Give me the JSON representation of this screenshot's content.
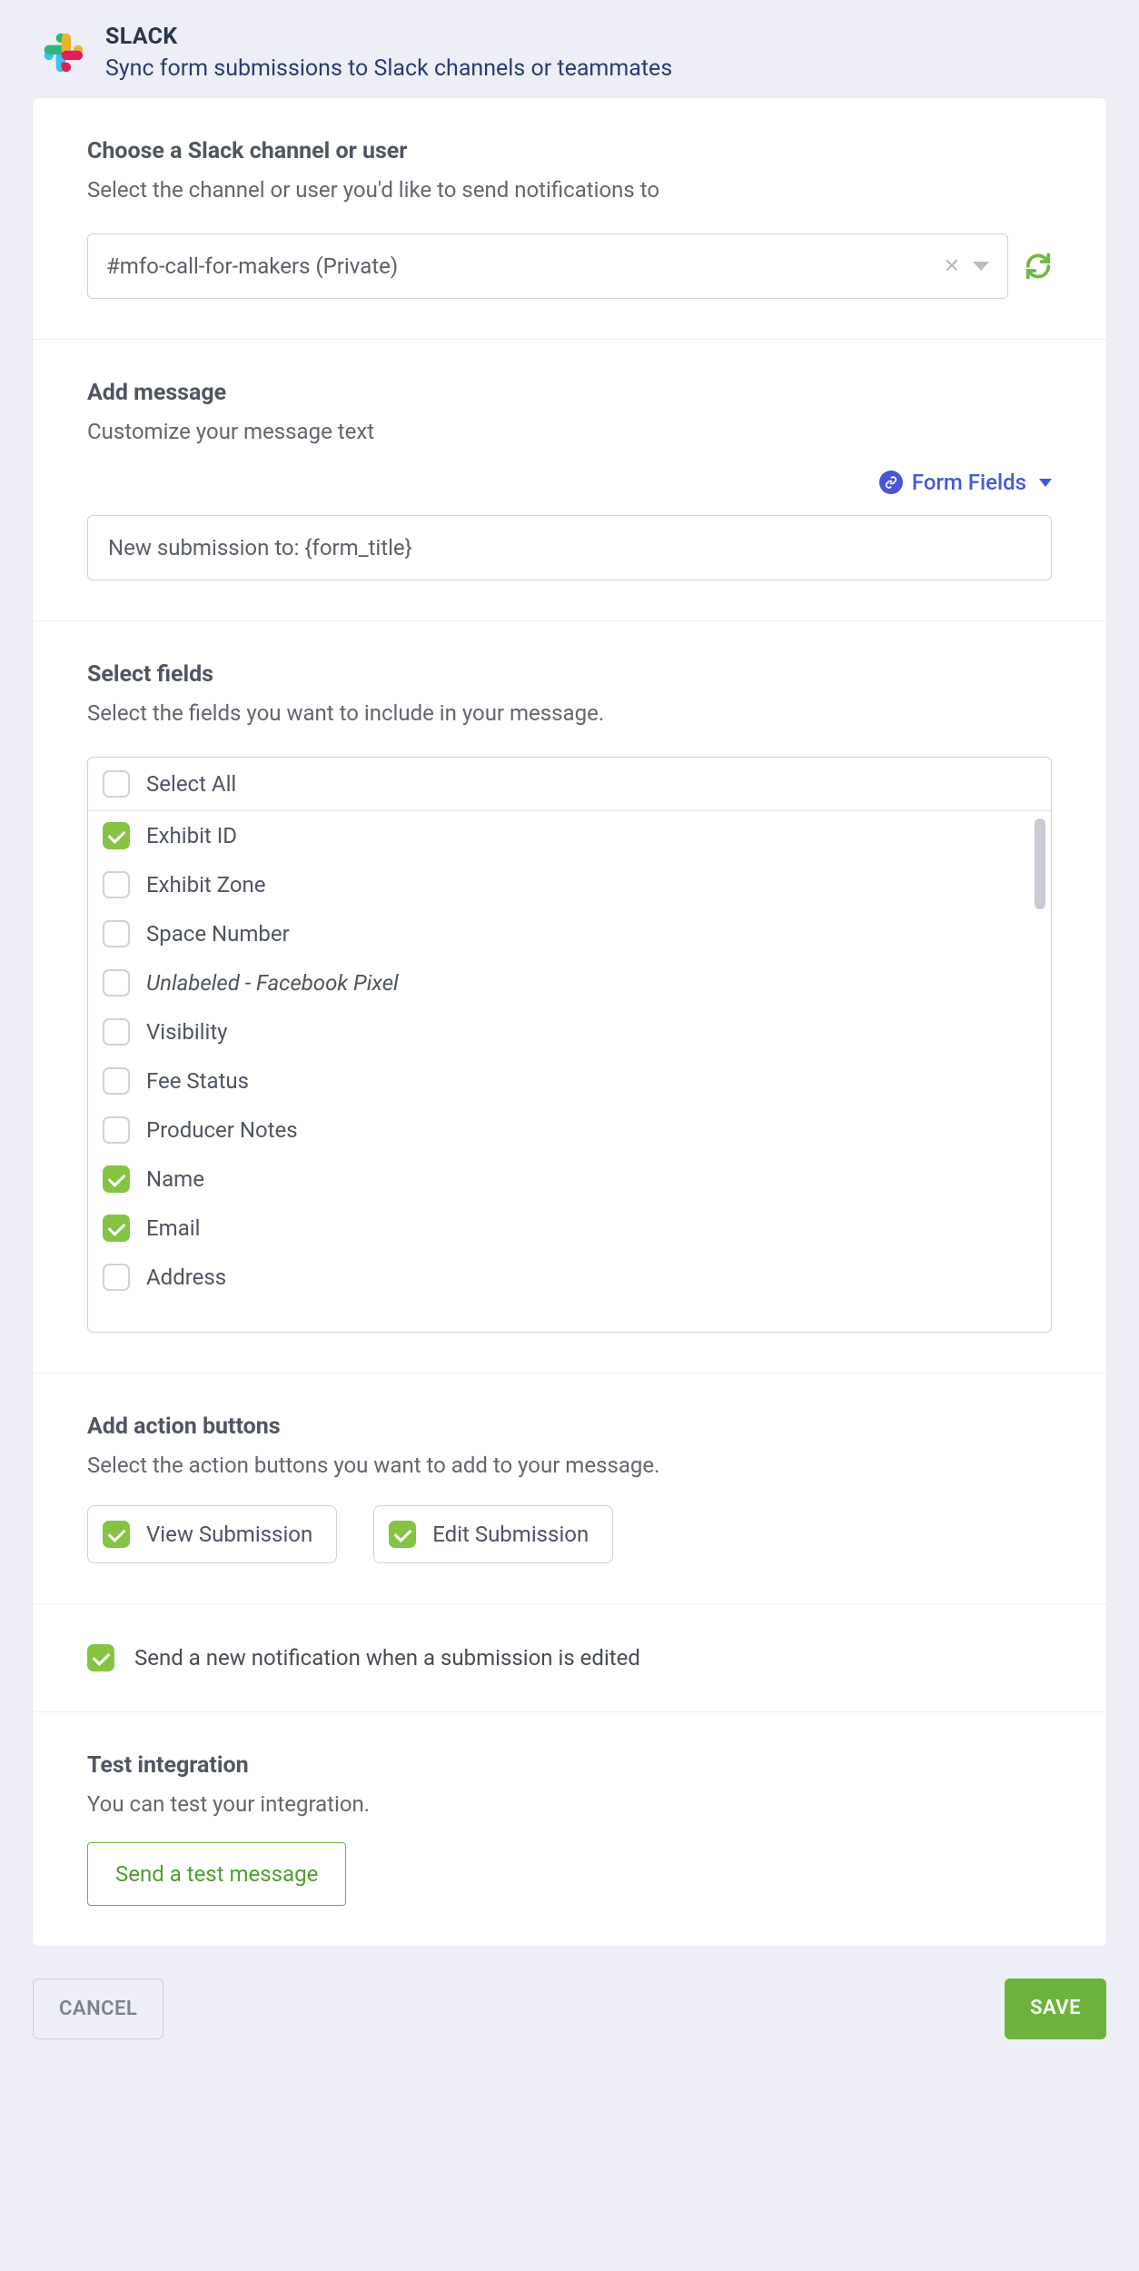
{
  "header": {
    "title": "SLACK",
    "subtitle": "Sync form submissions to Slack channels or teammates"
  },
  "channel_section": {
    "title": "Choose a Slack channel or user",
    "subtitle": "Select the channel or user you'd like to send notifications to",
    "selected": "#mfo-call-for-makers (Private)"
  },
  "message_section": {
    "title": "Add message",
    "subtitle": "Customize your message text",
    "form_fields_link": "Form Fields",
    "value": "New submission to: {form_title}"
  },
  "fields_section": {
    "title": "Select fields",
    "subtitle": "Select the fields you want to include in your message.",
    "select_all_label": "Select All",
    "items": [
      {
        "label": "Exhibit ID",
        "checked": true
      },
      {
        "label": "Exhibit Zone",
        "checked": false
      },
      {
        "label": "Space Number",
        "checked": false
      },
      {
        "label": "Unlabeled - Facebook Pixel",
        "checked": false,
        "italic": true
      },
      {
        "label": "Visibility",
        "checked": false
      },
      {
        "label": "Fee Status",
        "checked": false
      },
      {
        "label": "Producer Notes",
        "checked": false
      },
      {
        "label": "Name",
        "checked": true
      },
      {
        "label": "Email",
        "checked": true
      },
      {
        "label": "Address",
        "checked": false
      }
    ]
  },
  "action_section": {
    "title": "Add action buttons",
    "subtitle": "Select the action buttons you want to add to your message.",
    "buttons": [
      {
        "label": "View Submission",
        "checked": true
      },
      {
        "label": "Edit Submission",
        "checked": true
      }
    ]
  },
  "notify_section": {
    "label": "Send a new notification when a submission is edited",
    "checked": true
  },
  "test_section": {
    "title": "Test integration",
    "subtitle": "You can test your integration.",
    "button": "Send a test message"
  },
  "footer": {
    "cancel": "CANCEL",
    "save": "SAVE"
  }
}
